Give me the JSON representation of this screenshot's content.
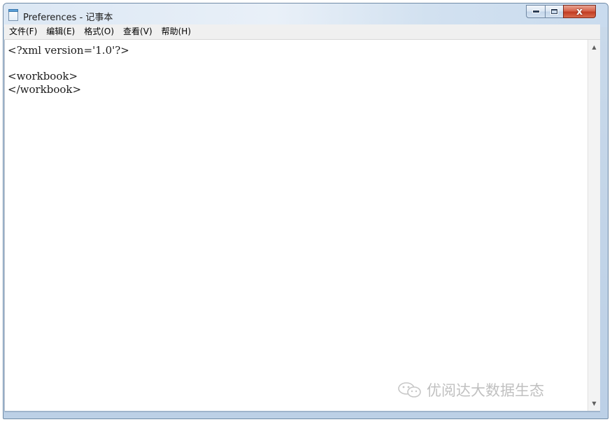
{
  "window": {
    "title": "Preferences - 记事本"
  },
  "controls": {
    "minimize_icon": "minimize-icon",
    "maximize_icon": "maximize-icon",
    "close_icon": "close-icon",
    "close_glyph": "x"
  },
  "menu": {
    "items": [
      {
        "label": "文件(F)"
      },
      {
        "label": "编辑(E)"
      },
      {
        "label": "格式(O)"
      },
      {
        "label": "查看(V)"
      },
      {
        "label": "帮助(H)"
      }
    ]
  },
  "editor": {
    "lines": [
      "<?xml version='1.0'?>",
      "",
      "<workbook>",
      "</workbook>"
    ]
  },
  "watermark": {
    "text": "优阅达大数据生态"
  },
  "colors": {
    "titlebar": "#dbe7f4",
    "close_button": "#c23c22",
    "menubar": "#f0f0f0",
    "editor_bg": "#ffffff"
  }
}
